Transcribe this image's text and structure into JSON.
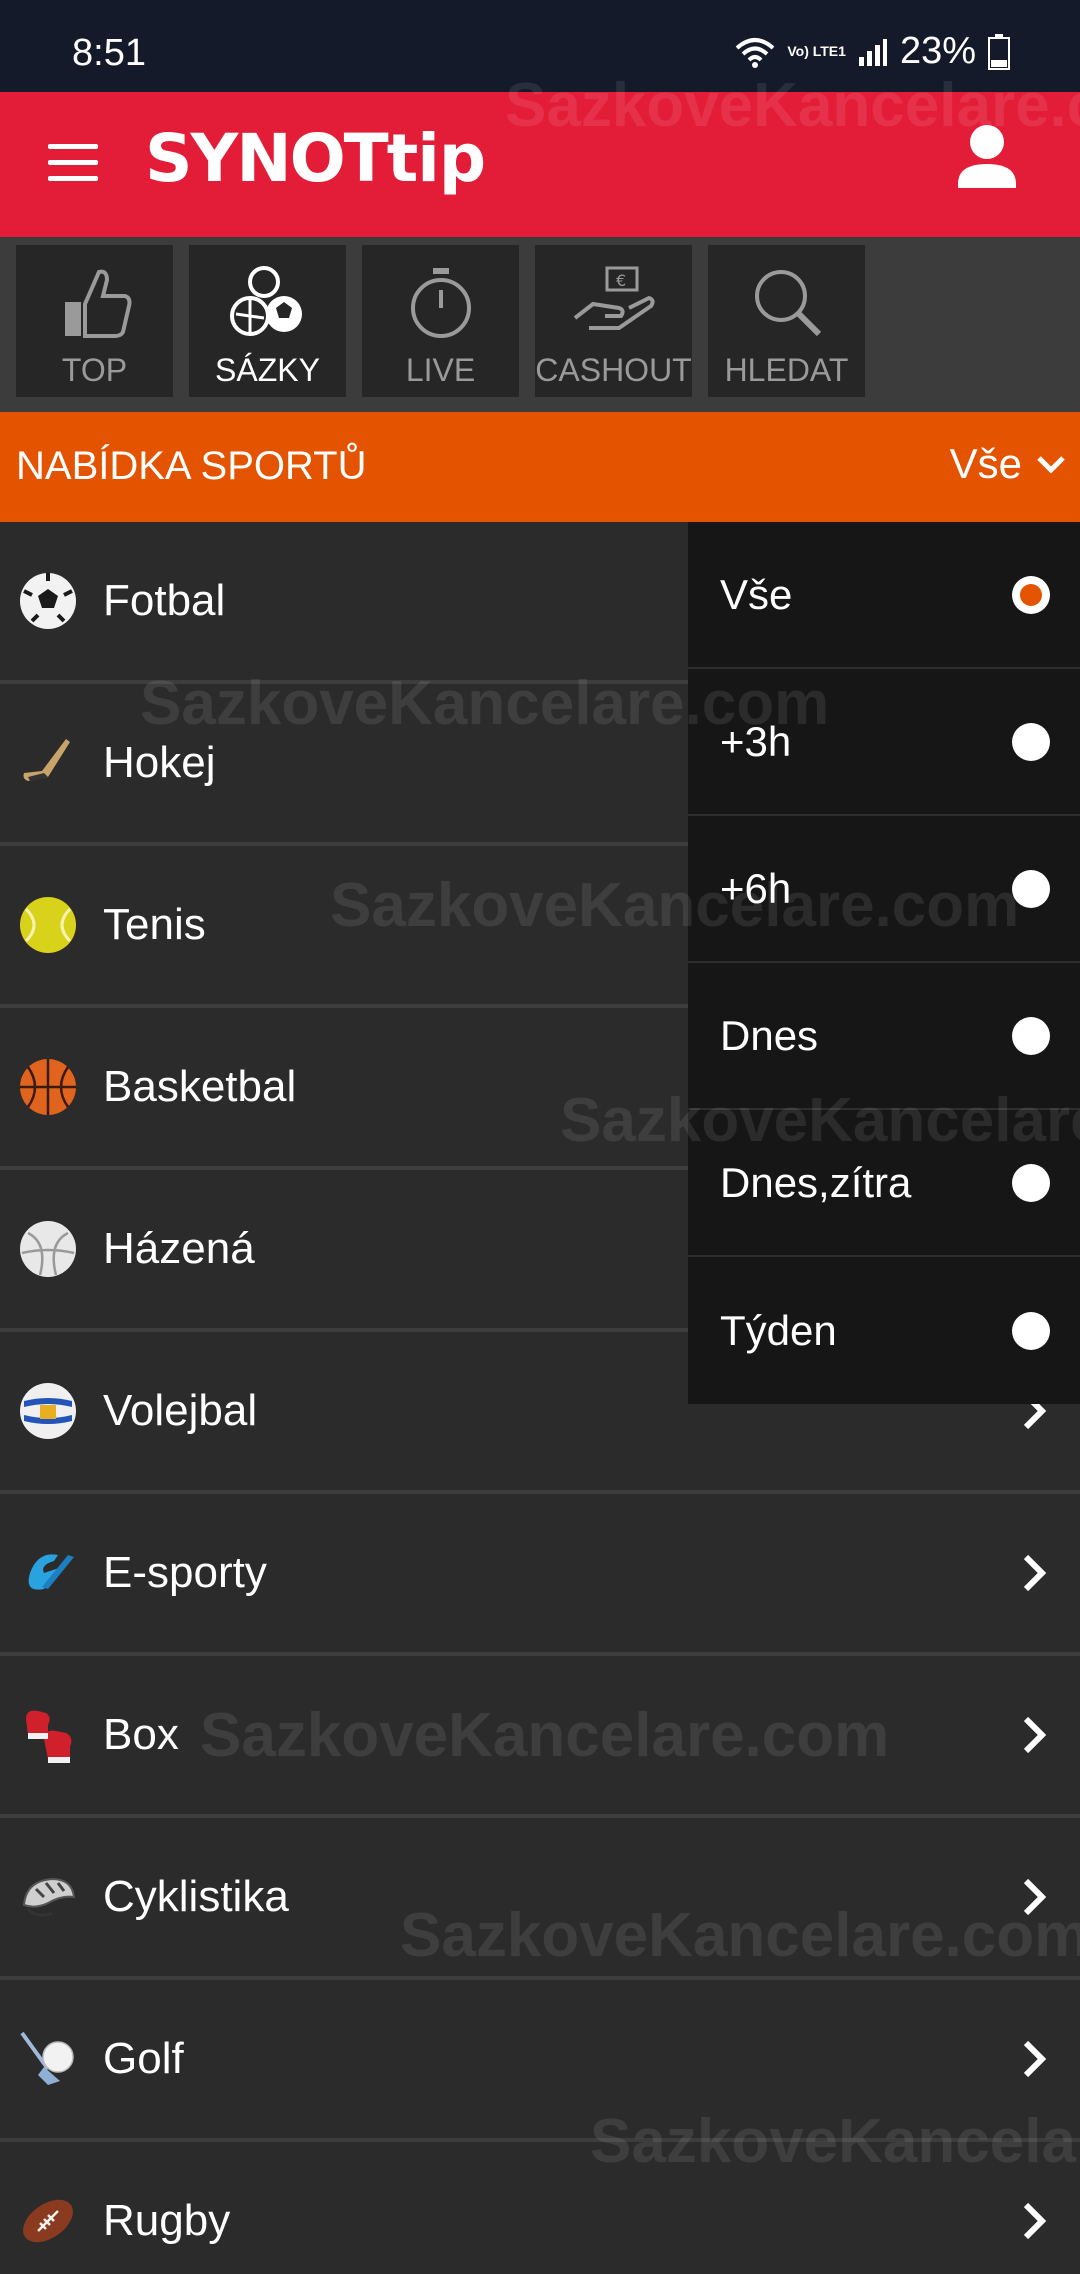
{
  "status_bar": {
    "time": "8:51",
    "network": "Vo) LTE1",
    "battery": "23%"
  },
  "header": {
    "logo_main": "SYNOT",
    "logo_accent": "tip"
  },
  "tabs": [
    {
      "label": "TOP",
      "icon": "thumbs-up-icon",
      "active": false
    },
    {
      "label": "SÁZKY",
      "icon": "sports-balls-icon",
      "active": true
    },
    {
      "label": "LIVE",
      "icon": "stopwatch-icon",
      "active": false
    },
    {
      "label": "CASHOUT",
      "icon": "cash-hand-icon",
      "active": false
    },
    {
      "label": "HLEDAT",
      "icon": "magnifier-icon",
      "active": false
    }
  ],
  "section": {
    "title": "NABÍDKA SPORTŮ",
    "filter_label": "Vše"
  },
  "sports": [
    {
      "name": "Fotbal",
      "icon": "football-icon"
    },
    {
      "name": "Hokej",
      "icon": "hockey-stick-icon"
    },
    {
      "name": "Tenis",
      "icon": "tennis-ball-icon"
    },
    {
      "name": "Basketbal",
      "icon": "basketball-icon"
    },
    {
      "name": "Házená",
      "icon": "handball-icon"
    },
    {
      "name": "Volejbal",
      "icon": "volleyball-icon"
    },
    {
      "name": "E-sporty",
      "icon": "esports-icon"
    },
    {
      "name": "Box",
      "icon": "boxing-glove-icon"
    },
    {
      "name": "Cyklistika",
      "icon": "cycling-helmet-icon"
    },
    {
      "name": "Golf",
      "icon": "golf-icon"
    },
    {
      "name": "Rugby",
      "icon": "rugby-ball-icon"
    }
  ],
  "dropdown": {
    "options": [
      {
        "label": "Vše",
        "selected": true
      },
      {
        "label": "+3h",
        "selected": false
      },
      {
        "label": "+6h",
        "selected": false
      },
      {
        "label": "Dnes",
        "selected": false
      },
      {
        "label": "Dnes,zítra",
        "selected": false
      },
      {
        "label": "Týden",
        "selected": false
      }
    ]
  },
  "watermark": {
    "text": "SazkoveKancelare.com"
  },
  "colors": {
    "brand_red": "#e31d38",
    "accent_orange": "#e35300",
    "list_bg": "#2b2b2b",
    "dropdown_bg": "#161616"
  }
}
